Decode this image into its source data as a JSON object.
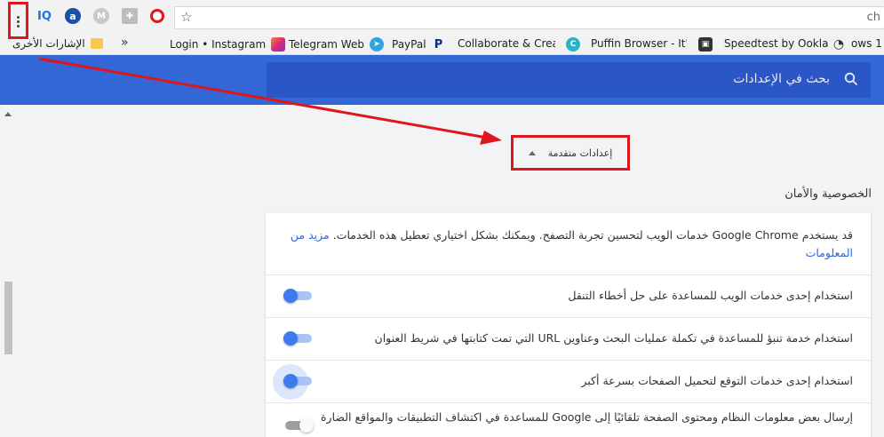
{
  "omnibox": {
    "text": "ch"
  },
  "bookmarks": {
    "other": "الإشارات الأخرى",
    "items": [
      {
        "label": "Login • Instagram",
        "icon": ""
      },
      {
        "label": "Telegram Web",
        "icon": "IG"
      },
      {
        "label": "PayPal",
        "icon": "➤"
      },
      {
        "label": "Collaborate & Create",
        "icon": "P"
      },
      {
        "label": "Puffin Browser - It's",
        "icon": "C"
      },
      {
        "label": "Speedtest by Ookla",
        "icon": "▣"
      },
      {
        "label": "ows 1",
        "icon": "◔"
      }
    ]
  },
  "header": {
    "search_placeholder": "بحث في الإعدادات"
  },
  "advanced": {
    "label": "إعدادات متقدمة"
  },
  "privacy": {
    "title": "الخصوصية والأمان",
    "intro": "قد يستخدم Google Chrome خدمات الويب لتحسين تجربة التصفح. ويمكنك بشكل اختياري تعطيل هذه الخدمات.",
    "learn_more": "مزيد من المعلومات",
    "rows": [
      {
        "label": "استخدام إحدى خدمات الويب للمساعدة على حل أخطاء التنقل",
        "on": true
      },
      {
        "label": "استخدام خدمة تنبؤ للمساعدة في تكملة عمليات البحث وعناوين URL التي تمت كتابتها في شريط العنوان",
        "on": true
      },
      {
        "label": "استخدام إحدى خدمات التوقع لتحميل الصفحات بسرعة أكبر",
        "on": true
      },
      {
        "label": "إرسال بعض معلومات النظام ومحتوى الصفحة تلقائيًا إلى Google للمساعدة في اكتشاف التطبيقات والمواقع الضارة",
        "on": false
      }
    ]
  },
  "colors": {
    "accent": "#3367d6",
    "annotation": "#e0161e",
    "toggle_on": "#3f7bea"
  }
}
